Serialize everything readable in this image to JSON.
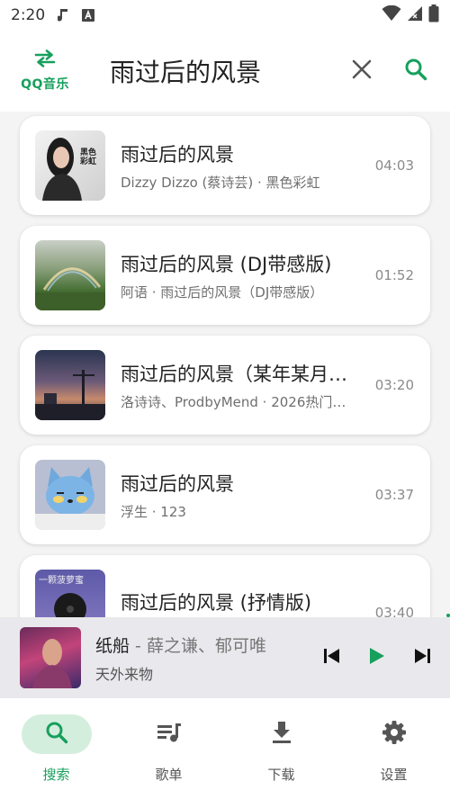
{
  "status_bar": {
    "time": "2:20"
  },
  "header": {
    "brand": "QQ音乐",
    "query": "雨过后的风景"
  },
  "songs": [
    {
      "title": "雨过后的风景",
      "subtitle": "Dizzy Dizzo (蔡诗芸) · 黑色彩虹",
      "duration": "04:03",
      "cover_text": "黑色彩虹"
    },
    {
      "title": "雨过后的风景 (DJ带感版)",
      "subtitle": "阿语 · 雨过后的风景（DJ带感版）",
      "duration": "01:52"
    },
    {
      "title": "雨过后的风景（某年某月…",
      "subtitle": "洛诗诗、ProdbyMend · 2026热门…",
      "duration": "03:20"
    },
    {
      "title": "雨过后的风景",
      "subtitle": "浮生 · 123",
      "duration": "03:37"
    },
    {
      "title": "雨过后的风景 (抒情版)",
      "subtitle": "",
      "duration": "03:40",
      "cover_text": "一颗菠萝蜜"
    }
  ],
  "player": {
    "title": "纸船",
    "artist": " - 薛之谦、郁可唯",
    "album": "天外来物"
  },
  "nav": {
    "search": "搜索",
    "playlist": "歌单",
    "download": "下载",
    "settings": "设置"
  },
  "colors": {
    "accent": "#16a05c",
    "nav_active_bg": "#d4eede",
    "player_bg": "#e9e8ec"
  }
}
